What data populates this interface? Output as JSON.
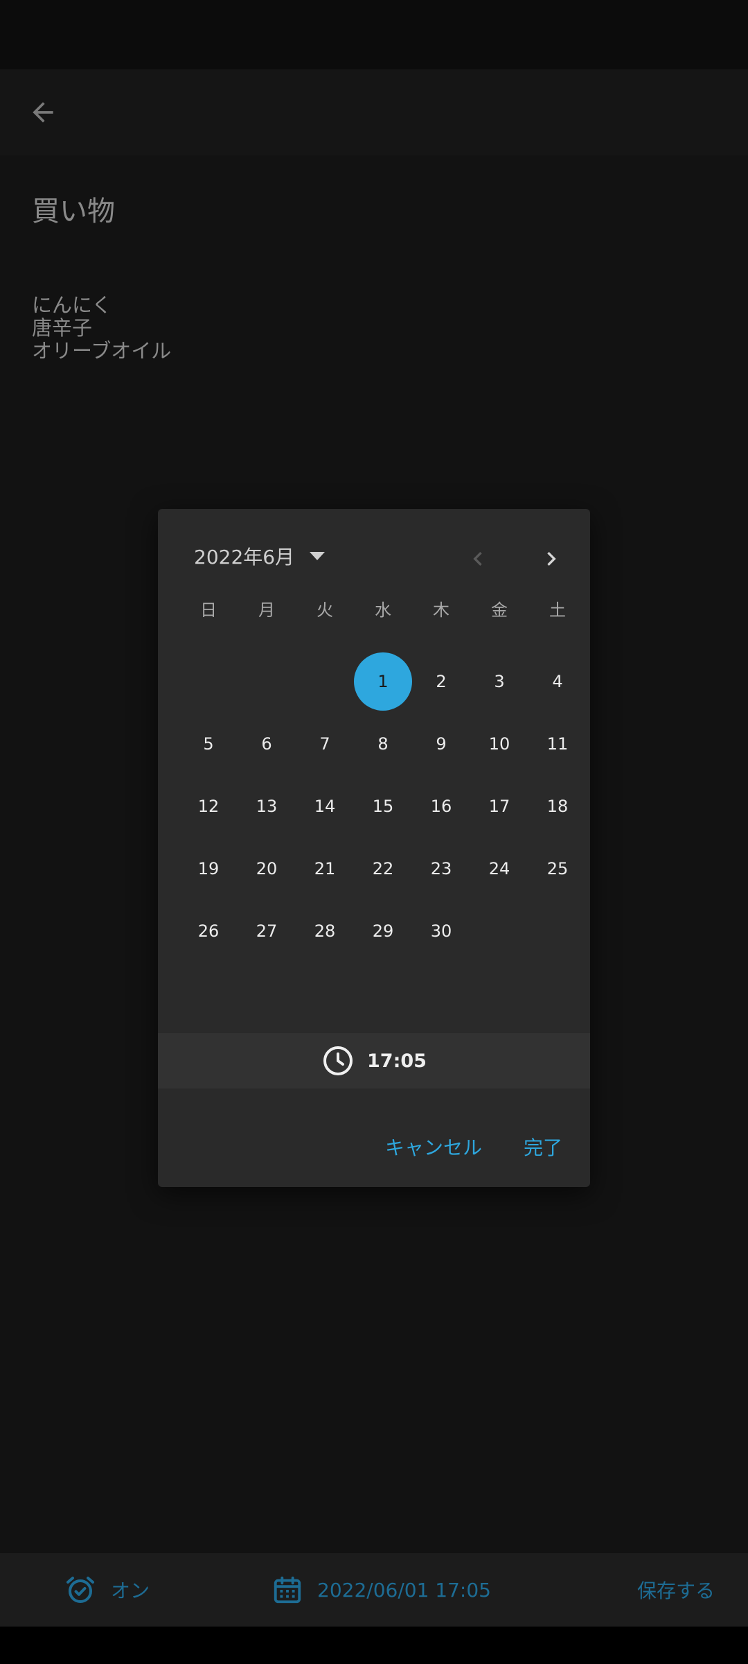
{
  "note": {
    "title": "買い物",
    "lines": [
      "にんにく",
      "唐辛子",
      "オリーブオイル"
    ]
  },
  "dialog": {
    "month_label": "2022年6月",
    "weekdays": [
      "日",
      "月",
      "火",
      "水",
      "木",
      "金",
      "土"
    ],
    "first_weekday_index": 3,
    "days_in_month": 30,
    "selected_day": 1,
    "days": [
      "1",
      "2",
      "3",
      "4",
      "5",
      "6",
      "7",
      "8",
      "9",
      "10",
      "11",
      "12",
      "13",
      "14",
      "15",
      "16",
      "17",
      "18",
      "19",
      "20",
      "21",
      "22",
      "23",
      "24",
      "25",
      "26",
      "27",
      "28",
      "29",
      "30"
    ],
    "time": "17:05",
    "cancel_label": "キャンセル",
    "done_label": "完了"
  },
  "bottom_bar": {
    "alarm_label": "オン",
    "datetime_label": "2022/06/01 17:05",
    "save_label": "保存する"
  },
  "colors": {
    "accent": "#2ea7de",
    "dim_accent": "#1d6c94",
    "background": "#121212",
    "dialog": "#2a2a2a"
  },
  "icons": {
    "back": "arrow-left-icon",
    "prev": "chevron-left-icon",
    "next": "chevron-right-icon",
    "clock": "clock-icon",
    "alarm": "alarm-icon",
    "calendar": "calendar-icon"
  }
}
